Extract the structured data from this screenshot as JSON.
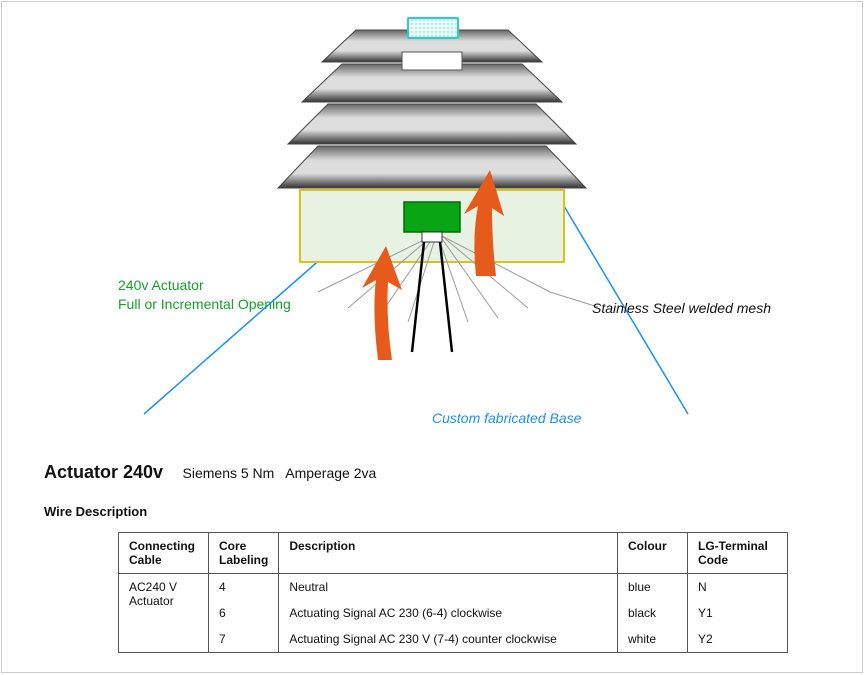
{
  "labels": {
    "actuator_line1": "240v Actuator",
    "actuator_line2": "Full or Incremental Opening",
    "mesh": "Stainless Steel welded mesh",
    "base": "Custom fabricated Base"
  },
  "title": {
    "main": "Actuator 240v",
    "sub1": "Siemens 5 Nm",
    "sub2": "Amperage 2va"
  },
  "wire_description_heading": "Wire Description",
  "table": {
    "headers": {
      "cable": "Connecting Cable",
      "core": "Core Labeling",
      "desc": "Description",
      "colour": "Colour",
      "code": "LG-Terminal Code"
    },
    "cable_group": "AC240 V Actuator",
    "rows": [
      {
        "core": "4",
        "desc": "Neutral",
        "colour": "blue",
        "code": "N"
      },
      {
        "core": "6",
        "desc": "Actuating Signal AC 230 (6-4) clockwise",
        "colour": "black",
        "code": "Y1"
      },
      {
        "core": "7",
        "desc": "Actuating Signal AC 230 V (7-4) counter clockwise",
        "colour": "white",
        "code": "Y2"
      }
    ]
  },
  "chart_data": {
    "type": "diagram",
    "title": "Actuator 240v assembly",
    "components": [
      {
        "name": "Louver stack (4 louvers)",
        "note": "top of assembly"
      },
      {
        "name": "Top mesh insert",
        "note": "cyan bordered, dotted fill"
      },
      {
        "name": "Top vent panel",
        "note": "white rectangle"
      },
      {
        "name": "240v Actuator",
        "note": "green block, full or incremental opening"
      },
      {
        "name": "Custom fabricated Base",
        "note": "yellow bordered light-green box"
      },
      {
        "name": "Stainless Steel welded mesh",
        "note": "radiating grey lines"
      },
      {
        "name": "Airflow arrows",
        "note": "two orange upward arrows"
      },
      {
        "name": "Base lead lines",
        "note": "blue diagonal lines to base label"
      }
    ]
  }
}
